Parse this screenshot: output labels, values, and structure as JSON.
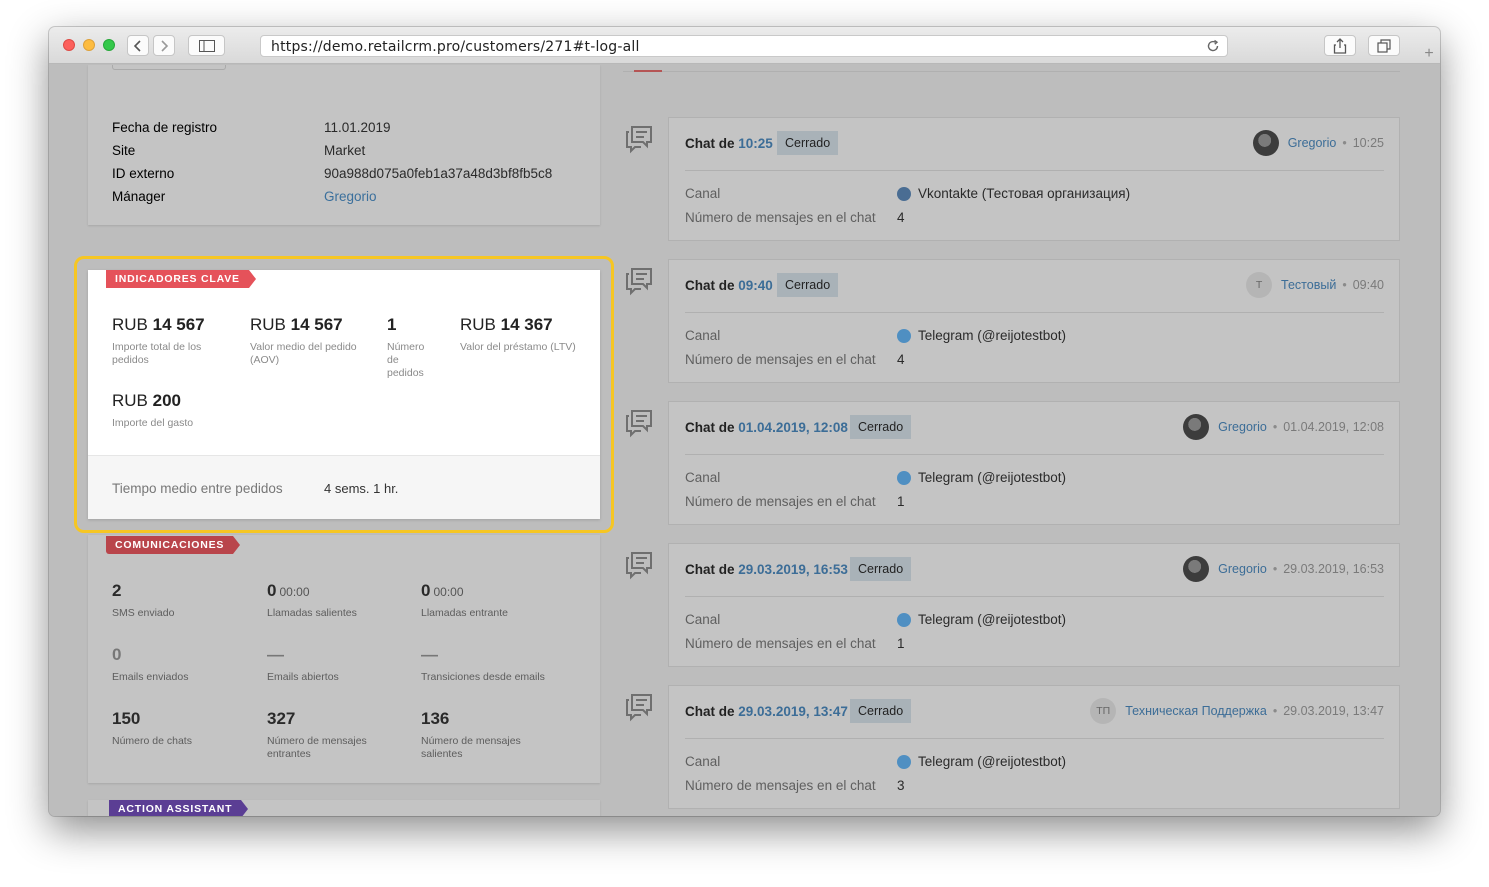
{
  "browser": {
    "url": "https://demo.retailcrm.pro/customers/271#t-log-all"
  },
  "customer_info": {
    "rows": [
      {
        "label": "Fecha de registro",
        "value": "11.01.2019"
      },
      {
        "label": "Site",
        "value": "Market"
      },
      {
        "label": "ID externo",
        "value": "90a988d075a0feb1a37a48d3bf8fb5c8"
      },
      {
        "label": "Mánager",
        "value": "Gregorio"
      }
    ]
  },
  "kpi": {
    "ribbon": "INDICADORES CLAVE",
    "items": [
      {
        "currency": "RUB",
        "amount": "14 567",
        "label": "Importe total de los pedidos"
      },
      {
        "currency": "RUB",
        "amount": "14 567",
        "label": "Valor medio del pedido (AOV)"
      },
      {
        "currency": "",
        "amount": "1",
        "label": "Número de pedidos"
      },
      {
        "currency": "RUB",
        "amount": "14 367",
        "label": "Valor del préstamo (LTV)"
      },
      {
        "currency": "RUB",
        "amount": "200",
        "label": "Importe del gasto"
      }
    ],
    "footer_label": "Tiempo medio entre pedidos",
    "footer_value": "4 sems. 1 hr."
  },
  "communications": {
    "ribbon": "COMUNICACIONES",
    "items": [
      {
        "value": "2",
        "sub": "",
        "label": "SMS enviado"
      },
      {
        "value": "0",
        "sub": "00:00",
        "label": "Llamadas salientes"
      },
      {
        "value": "0",
        "sub": "00:00",
        "label": "Llamadas entrante"
      },
      {
        "value": "0",
        "sub": "",
        "label": "Emails enviados"
      },
      {
        "value": "—",
        "sub": "",
        "label": "Emails abiertos"
      },
      {
        "value": "—",
        "sub": "",
        "label": "Transiciones desde emails"
      },
      {
        "value": "150",
        "sub": "",
        "label": "Número de chats"
      },
      {
        "value": "327",
        "sub": "",
        "label": "Número de mensajes entrantes"
      },
      {
        "value": "136",
        "sub": "",
        "label": "Número de mensajes salientes"
      }
    ]
  },
  "action_assistant": {
    "ribbon": "ACTION ASSISTANT"
  },
  "chats": {
    "title_prefix": "Chat de",
    "channel_label": "Canal",
    "count_label": "Número de mensajes en el chat",
    "items": [
      {
        "time": "10:25",
        "status": "Cerrado",
        "author": "Gregorio",
        "author_initials": "",
        "author_time": "10:25",
        "channel": "Vkontakte (Тестовая организация)",
        "channel_icon": "vk-icon",
        "count": "4"
      },
      {
        "time": "09:40",
        "status": "Cerrado",
        "author": "Тестовый",
        "author_initials": "T",
        "author_time": "09:40",
        "channel": "Telegram (@reijotestbot)",
        "channel_icon": "telegram-icon",
        "count": "4"
      },
      {
        "time": "01.04.2019, 12:08",
        "status": "Cerrado",
        "author": "Gregorio",
        "author_initials": "",
        "author_time": "01.04.2019, 12:08",
        "channel": "Telegram (@reijotestbot)",
        "channel_icon": "telegram-icon",
        "count": "1"
      },
      {
        "time": "29.03.2019, 16:53",
        "status": "Cerrado",
        "author": "Gregorio",
        "author_initials": "",
        "author_time": "29.03.2019, 16:53",
        "channel": "Telegram (@reijotestbot)",
        "channel_icon": "telegram-icon",
        "count": "1"
      },
      {
        "time": "29.03.2019, 13:47",
        "status": "Cerrado",
        "author": "Техническая Поддержка",
        "author_initials": "ТП",
        "author_time": "29.03.2019, 13:47",
        "channel": "Telegram (@reijotestbot)",
        "channel_icon": "telegram-icon",
        "count": "3"
      }
    ]
  },
  "colors": {
    "kpi_ribbon": "#e5525a",
    "comm_ribbon": "#b9454b",
    "assistant_ribbon": "#5b3e94",
    "highlight": "#f6c623",
    "link": "#3c6d97"
  }
}
